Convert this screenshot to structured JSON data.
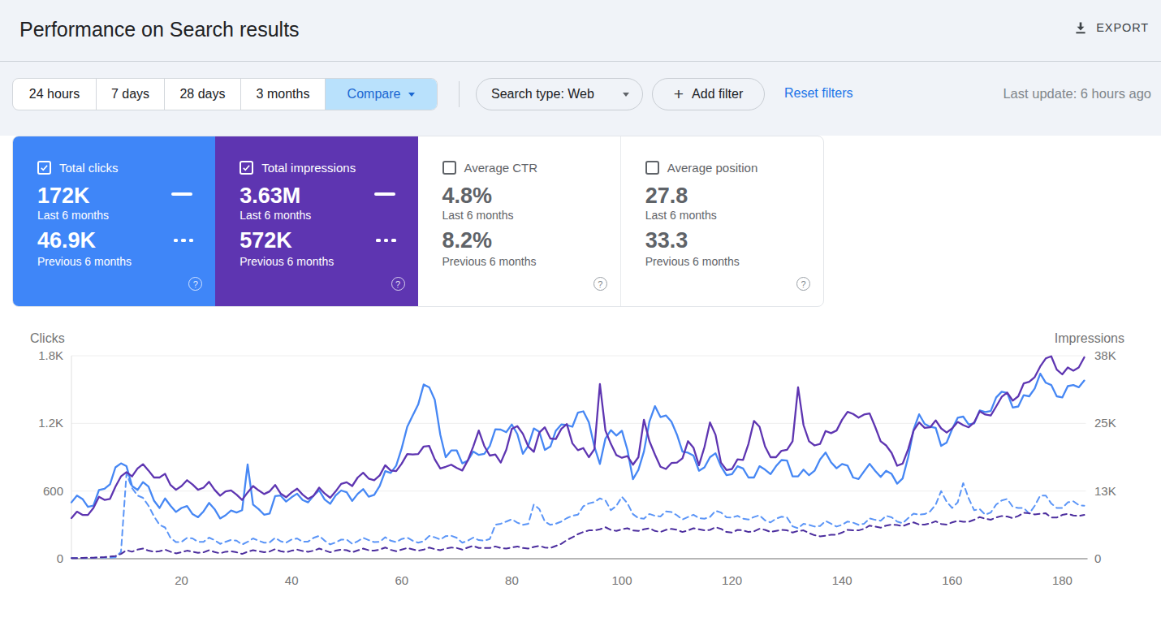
{
  "header": {
    "title": "Performance on Search results",
    "export_label": "EXPORT"
  },
  "filters": {
    "date_ranges": [
      "24 hours",
      "7 days",
      "28 days",
      "3 months"
    ],
    "compare_label": "Compare",
    "search_type": "Search type: Web",
    "add_filter_label": "Add filter",
    "reset_label": "Reset filters",
    "last_update": "Last update: 6 hours ago"
  },
  "cards": [
    {
      "id": "total-clicks",
      "label": "Total clicks",
      "checked": true,
      "bg": "#3f86f8",
      "value_last": "172K",
      "period_last": "Last 6 months",
      "value_prev": "46.9K",
      "period_prev": "Previous 6 months"
    },
    {
      "id": "total-impressions",
      "label": "Total impressions",
      "checked": true,
      "bg": "#5e35b1",
      "value_last": "3.63M",
      "period_last": "Last 6 months",
      "value_prev": "572K",
      "period_prev": "Previous 6 months"
    },
    {
      "id": "average-ctr",
      "label": "Average CTR",
      "checked": false,
      "bg": "",
      "value_last": "4.8%",
      "period_last": "Last 6 months",
      "value_prev": "8.2%",
      "period_prev": "Previous 6 months"
    },
    {
      "id": "average-position",
      "label": "Average position",
      "checked": false,
      "bg": "",
      "value_last": "27.8",
      "period_last": "Last 6 months",
      "value_prev": "33.3",
      "period_prev": "Previous 6 months"
    }
  ],
  "chart_data": {
    "type": "line",
    "x_unit": "day index (about 6 months, daily points)",
    "x_ticks": [
      20,
      40,
      60,
      80,
      100,
      120,
      140,
      160,
      180
    ],
    "x_step_between_points": 1,
    "left_axis": {
      "label": "Clicks",
      "ticks": [
        "0",
        "600",
        "1.2K",
        "1.8K"
      ],
      "max": 1800
    },
    "right_axis": {
      "label": "Impressions",
      "ticks": [
        "0",
        "13K",
        "25K",
        "38K"
      ],
      "max": 38000
    },
    "series": [
      {
        "name": "Total clicks – Last 6 months",
        "axis": "left",
        "style": "solid",
        "color": "#4687f4",
        "values": [
          500,
          560,
          530,
          460,
          470,
          610,
          620,
          660,
          810,
          845,
          820,
          645,
          610,
          680,
          640,
          515,
          450,
          535,
          470,
          415,
          450,
          467,
          395,
          368,
          420,
          495,
          440,
          357,
          385,
          428,
          410,
          430,
          835,
          480,
          440,
          390,
          400,
          555,
          560,
          507,
          545,
          577,
          520,
          500,
          560,
          607,
          525,
          487,
          560,
          605,
          590,
          512,
          575,
          617,
          550,
          567,
          645,
          777,
          760,
          825,
          980,
          1170,
          1270,
          1367,
          1545,
          1520,
          1410,
          1100,
          900,
          960,
          960,
          845,
          870,
          950,
          920,
          930,
          1000,
          1147,
          1145,
          1122,
          1190,
          1105,
          930,
          1002,
          1155,
          1125,
          965,
          995,
          1135,
          1190,
          1185,
          1170,
          1295,
          1307,
          1210,
          995,
          840,
          1065,
          1140,
          1092,
          1135,
          965,
          705,
          787,
          950,
          1216,
          1353,
          1256,
          1270,
          1215,
          1100,
          950,
          940,
          915,
          780,
          810,
          900,
          935,
          820,
          740,
          750,
          820,
          800,
          720,
          720,
          820,
          790,
          750,
          820,
          875,
          870,
          730,
          730,
          790,
          740,
          780,
          880,
          942,
          855,
          802,
          840,
          825,
          720,
          707,
          775,
          842,
          780,
          725,
          780,
          752,
          665,
          712,
          900,
          1145,
          1280,
          1195,
          1170,
          1160,
          1000,
          1030,
          1150,
          1250,
          1260,
          1190,
          1200,
          1315,
          1300,
          1310,
          1430,
          1480,
          1470,
          1340,
          1350,
          1450,
          1440,
          1510,
          1640,
          1560,
          1540,
          1440,
          1430,
          1530,
          1540,
          1520,
          1580
        ]
      },
      {
        "name": "Total impressions – Last 6 months",
        "axis": "right",
        "style": "solid",
        "color": "#5e35b1",
        "unit": "K",
        "values": [
          7.6,
          8.8,
          8.2,
          8.2,
          9.5,
          11.6,
          11.0,
          11.2,
          13.5,
          15.4,
          16.2,
          15.4,
          16.9,
          17.7,
          16.5,
          15.2,
          15.2,
          15.9,
          13.8,
          12.9,
          13.6,
          14.7,
          13.9,
          12.9,
          13.3,
          14.4,
          12.9,
          11.8,
          12.6,
          12.8,
          12.0,
          11.0,
          12.4,
          13.6,
          12.8,
          12.1,
          12.6,
          13.8,
          12.2,
          11.5,
          12.4,
          13.1,
          12.0,
          11.2,
          11.8,
          13.3,
          12.2,
          11.4,
          12.6,
          14.0,
          14.3,
          13.6,
          15.2,
          16.1,
          15.0,
          14.7,
          15.6,
          17.5,
          16.5,
          16.4,
          17.8,
          19.6,
          19.5,
          19.6,
          21.0,
          21.1,
          18.6,
          16.9,
          17.2,
          17.6,
          17.0,
          16.5,
          18.4,
          21.0,
          24.0,
          21.1,
          19.3,
          19.5,
          18.0,
          20.4,
          24.3,
          24.8,
          23.4,
          21.0,
          20.0,
          23.6,
          24.6,
          22.5,
          22.4,
          24.3,
          25.2,
          21.6,
          20.3,
          20.7,
          19.0,
          20.5,
          32.7,
          24.0,
          21.5,
          19.4,
          18.9,
          19.2,
          17.6,
          19.0,
          26.0,
          22.0,
          19.5,
          17.2,
          16.8,
          17.9,
          18.0,
          18.8,
          22.0,
          20.8,
          17.5,
          20.9,
          25.5,
          23.2,
          18.0,
          16.6,
          16.8,
          18.6,
          18.5,
          21.5,
          25.8,
          24.7,
          21.0,
          19.0,
          19.0,
          20.2,
          20.4,
          22.0,
          32.1,
          25.0,
          22.0,
          21.2,
          21.5,
          23.9,
          23.5,
          24.0,
          26.0,
          27.5,
          27.1,
          26.4,
          27.0,
          27.2,
          24.7,
          22.0,
          21.2,
          19.8,
          17.4,
          17.8,
          20.5,
          24.0,
          25.5,
          24.5,
          24.6,
          25.9,
          24.4,
          23.6,
          24.4,
          25.6,
          25.0,
          24.6,
          25.5,
          27.6,
          27.0,
          26.8,
          28.5,
          30.3,
          31.1,
          29.6,
          30.4,
          32.8,
          33.1,
          34.0,
          36.0,
          37.5,
          37.9,
          35.4,
          34.5,
          35.8,
          35.2,
          35.8,
          37.7
        ]
      },
      {
        "name": "Total clicks – Previous 6 months",
        "axis": "left",
        "style": "dashed",
        "color": "#5b95f7",
        "values": [
          5,
          5,
          5,
          6,
          8,
          12,
          10,
          8,
          12,
          60,
          755,
          627,
          560,
          540,
          470,
          375,
          300,
          277,
          185,
          147,
          150,
          185,
          180,
          150,
          150,
          187,
          165,
          132,
          150,
          167,
          160,
          125,
          150,
          180,
          160,
          142,
          145,
          185,
          155,
          142,
          170,
          180,
          150,
          152,
          185,
          202,
          160,
          127,
          145,
          169,
          170,
          132,
          155,
          185,
          165,
          147,
          150,
          190,
          160,
          147,
          175,
          187,
          160,
          142,
          155,
          202,
          190,
          170,
          200,
          204,
          185,
          142,
          160,
          187,
          165,
          160,
          175,
          300,
          310,
          330,
          350,
          320,
          300,
          310,
          480,
          440,
          330,
          300,
          310,
          330,
          360,
          380,
          390,
          465,
          490,
          502,
          535,
          517,
          430,
          469,
          549,
          492,
          395,
          360,
          355,
          397,
          380,
          375,
          420,
          414,
          385,
          347,
          370,
          390,
          360,
          355,
          370,
          425,
          410,
          367,
          365,
          380,
          355,
          347,
          370,
          385,
          340,
          322,
          355,
          372,
          365,
          287,
          270,
          310,
          300,
          285,
          290,
          335,
          310,
          285,
          300,
          330,
          320,
          300,
          310,
          357,
          345,
          337,
          380,
          367,
          330,
          315,
          360,
          400,
          390,
          395,
          420,
          480,
          600,
          505,
          450,
          500,
          670,
          535,
          430,
          440,
          390,
          410,
          480,
          517,
          530,
          460,
          450,
          450,
          400,
          470,
          560,
          560,
          490,
          450,
          450,
          500,
          510,
          475,
          470
        ]
      },
      {
        "name": "Total impressions – Previous 6 months",
        "axis": "right",
        "style": "dashed",
        "color": "#4c2e9e",
        "unit": "K",
        "values": [
          0.1,
          0.1,
          0.15,
          0.2,
          0.2,
          0.25,
          0.3,
          0.4,
          0.5,
          0.9,
          1.6,
          1.3,
          1.7,
          1.9,
          1.5,
          1.3,
          1.4,
          1.7,
          1.3,
          1.0,
          1.2,
          1.5,
          1.3,
          1.1,
          1.2,
          1.6,
          1.25,
          1.0,
          1.3,
          1.4,
          1.2,
          0.9,
          1.3,
          1.6,
          1.4,
          1.2,
          1.35,
          1.8,
          1.4,
          1.2,
          1.5,
          1.7,
          1.45,
          1.3,
          1.5,
          1.9,
          1.55,
          1.2,
          1.5,
          1.7,
          1.6,
          1.2,
          1.55,
          1.9,
          1.6,
          1.5,
          1.7,
          2.1,
          1.65,
          1.4,
          1.7,
          2.0,
          1.75,
          1.5,
          1.7,
          2.1,
          1.8,
          1.6,
          1.9,
          2.1,
          2.0,
          1.7,
          2.1,
          2.4,
          2.0,
          2.0,
          2.0,
          2.3,
          2.0,
          1.9,
          2.1,
          2.3,
          2.0,
          1.9,
          2.2,
          2.4,
          2.1,
          2.0,
          2.4,
          2.8,
          3.5,
          4.0,
          4.6,
          5.0,
          5.3,
          5.3,
          5.5,
          5.9,
          5.4,
          5.2,
          5.5,
          5.7,
          5.3,
          5.2,
          5.5,
          5.7,
          5.2,
          5.0,
          5.4,
          5.6,
          5.4,
          5.0,
          5.3,
          5.7,
          5.5,
          5.3,
          5.4,
          5.9,
          5.6,
          5.0,
          4.9,
          5.4,
          5.3,
          5.0,
          5.1,
          5.6,
          5.4,
          5.0,
          5.2,
          5.4,
          5.3,
          4.9,
          5.2,
          5.3,
          4.8,
          4.4,
          4.2,
          4.3,
          4.5,
          4.5,
          4.9,
          5.4,
          5.3,
          5.3,
          5.6,
          6.2,
          6.0,
          5.8,
          6.2,
          6.4,
          6.3,
          6.1,
          6.5,
          6.8,
          6.4,
          6.4,
          6.6,
          7.0,
          6.5,
          6.4,
          6.8,
          7.1,
          6.9,
          6.9,
          7.3,
          7.8,
          7.5,
          7.3,
          7.7,
          8.0,
          7.9,
          7.6,
          8.0,
          8.6,
          8.5,
          8.3,
          8.4,
          8.5,
          7.7,
          7.7,
          8.2,
          8.4,
          8.1,
          8.0,
          8.2
        ]
      }
    ]
  }
}
